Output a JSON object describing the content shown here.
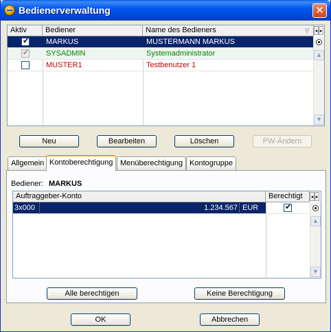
{
  "window": {
    "title": "Bedienerverwaltung"
  },
  "users_table": {
    "columns": [
      "Aktiv",
      "Bediener",
      "Name des Bedieners"
    ],
    "rows": [
      {
        "active": true,
        "user": "MARKUS",
        "name": "MUSTERMANN MARKUS",
        "selected": true,
        "color": "#ffffff"
      },
      {
        "active": true,
        "user": "SYSADMIN",
        "name": "Systemadministrator",
        "selected": false,
        "disabled": true,
        "color": "#008000"
      },
      {
        "active": false,
        "user": "MUSTER1",
        "name": "Testbenutzer 1",
        "selected": false,
        "color": "#cc0000"
      }
    ]
  },
  "actions": {
    "new": "Neu",
    "edit": "Bearbeiten",
    "delete": "Löschen",
    "pw_change": "PW-Ändern"
  },
  "tabs": [
    "Allgemein",
    "Kontoberechtigung",
    "Menüberechtigung",
    "Kontogruppe"
  ],
  "active_tab": 1,
  "permission": {
    "operator_label": "Bediener:",
    "operator_value": "MARKUS",
    "columns": [
      "Auftraggeber-Konto",
      "Berechtigt"
    ],
    "rows": [
      {
        "account": "3x000",
        "amount": "1.234.567",
        "currency": "EUR",
        "allowed": true
      }
    ],
    "grant_all": "Alle berechtigen",
    "revoke_all": "Keine Berechtigung"
  },
  "dialog": {
    "ok": "OK",
    "cancel": "Abbrechen"
  },
  "colors": {
    "selection": "#0a246a",
    "title_bar": "#0058ee",
    "active_tab_accent": "#ff9c00"
  }
}
